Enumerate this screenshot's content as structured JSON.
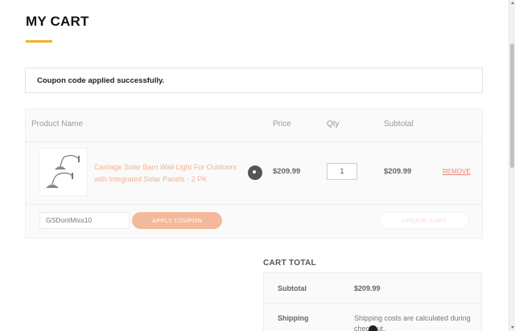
{
  "page": {
    "title": "MY CART",
    "accent_color": "#f0b429"
  },
  "notice": {
    "text": "Coupon code applied successfully."
  },
  "cart": {
    "columns": {
      "product": "Product Name",
      "price": "Price",
      "qty": "Qty",
      "subtotal": "Subtotal"
    },
    "items": [
      {
        "name": "Carriage Solar Barn Wall Light For Outdoors with Integrated Solar Panels - 2 PK",
        "price": "$209.99",
        "qty": "1",
        "subtotal": "$209.99",
        "remove_label": "REMOVE",
        "image_icon": "barn-light-product-image"
      }
    ],
    "coupon": {
      "value": "GSDontMiss10",
      "apply_label": "APPLY COUPON",
      "apply_color": "#f4b99a"
    },
    "update_label": "UPDATE CART"
  },
  "totals": {
    "title": "CART TOTAL",
    "subtotal_label": "Subtotal",
    "subtotal_value": "$209.99",
    "shipping_label": "Shipping",
    "shipping_value": "Shipping costs are calculated during checkout."
  }
}
